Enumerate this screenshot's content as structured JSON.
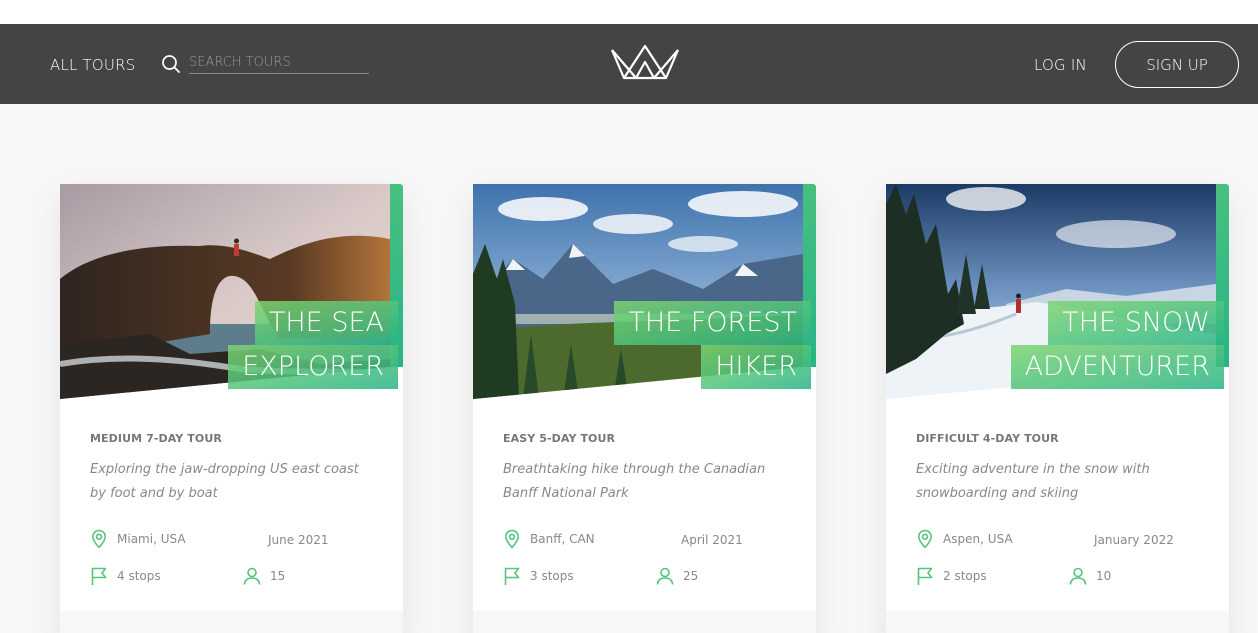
{
  "header": {
    "all_tours_label": "ALL TOURS",
    "search_placeholder": "SEARCH TOURS",
    "search_value": "",
    "logo_icon": "crown-logo-icon",
    "login_label": "LOG IN",
    "signup_label": "SIGN UP"
  },
  "colors": {
    "header_bg": "#444444",
    "page_bg": "#f7f7f7",
    "accent_light": "#7dd56f",
    "accent_dark": "#28b487"
  },
  "tours": [
    {
      "title_line1": "THE SEA",
      "title_line2": "EXPLORER",
      "difficulty": "MEDIUM 7-DAY TOUR",
      "summary": "Exploring the jaw-dropping US east coast by foot and by boat",
      "location": "Miami, USA",
      "date": "June 2021",
      "stops": "4 stops",
      "people": "15",
      "image": "rocky sea arch at sunset"
    },
    {
      "title_line1": "THE FOREST",
      "title_line2": "HIKER",
      "difficulty": "EASY 5-DAY TOUR",
      "summary": "Breathtaking hike through the Canadian Banff National Park",
      "location": "Banff, CAN",
      "date": "April 2021",
      "stops": "3 stops",
      "people": "25",
      "image": "mountains and pine forest"
    },
    {
      "title_line1": "THE SNOW",
      "title_line2": "ADVENTURER",
      "difficulty": "DIFFICULT 4-DAY TOUR",
      "summary": "Exciting adventure in the snow with snowboarding and skiing",
      "location": "Aspen, USA",
      "date": "January 2022",
      "stops": "2 stops",
      "people": "10",
      "image": "snowy trail with pine trees"
    }
  ],
  "icons": {
    "location": "map-pin-icon",
    "stops": "flag-icon",
    "people": "user-icon",
    "search": "search-icon"
  }
}
